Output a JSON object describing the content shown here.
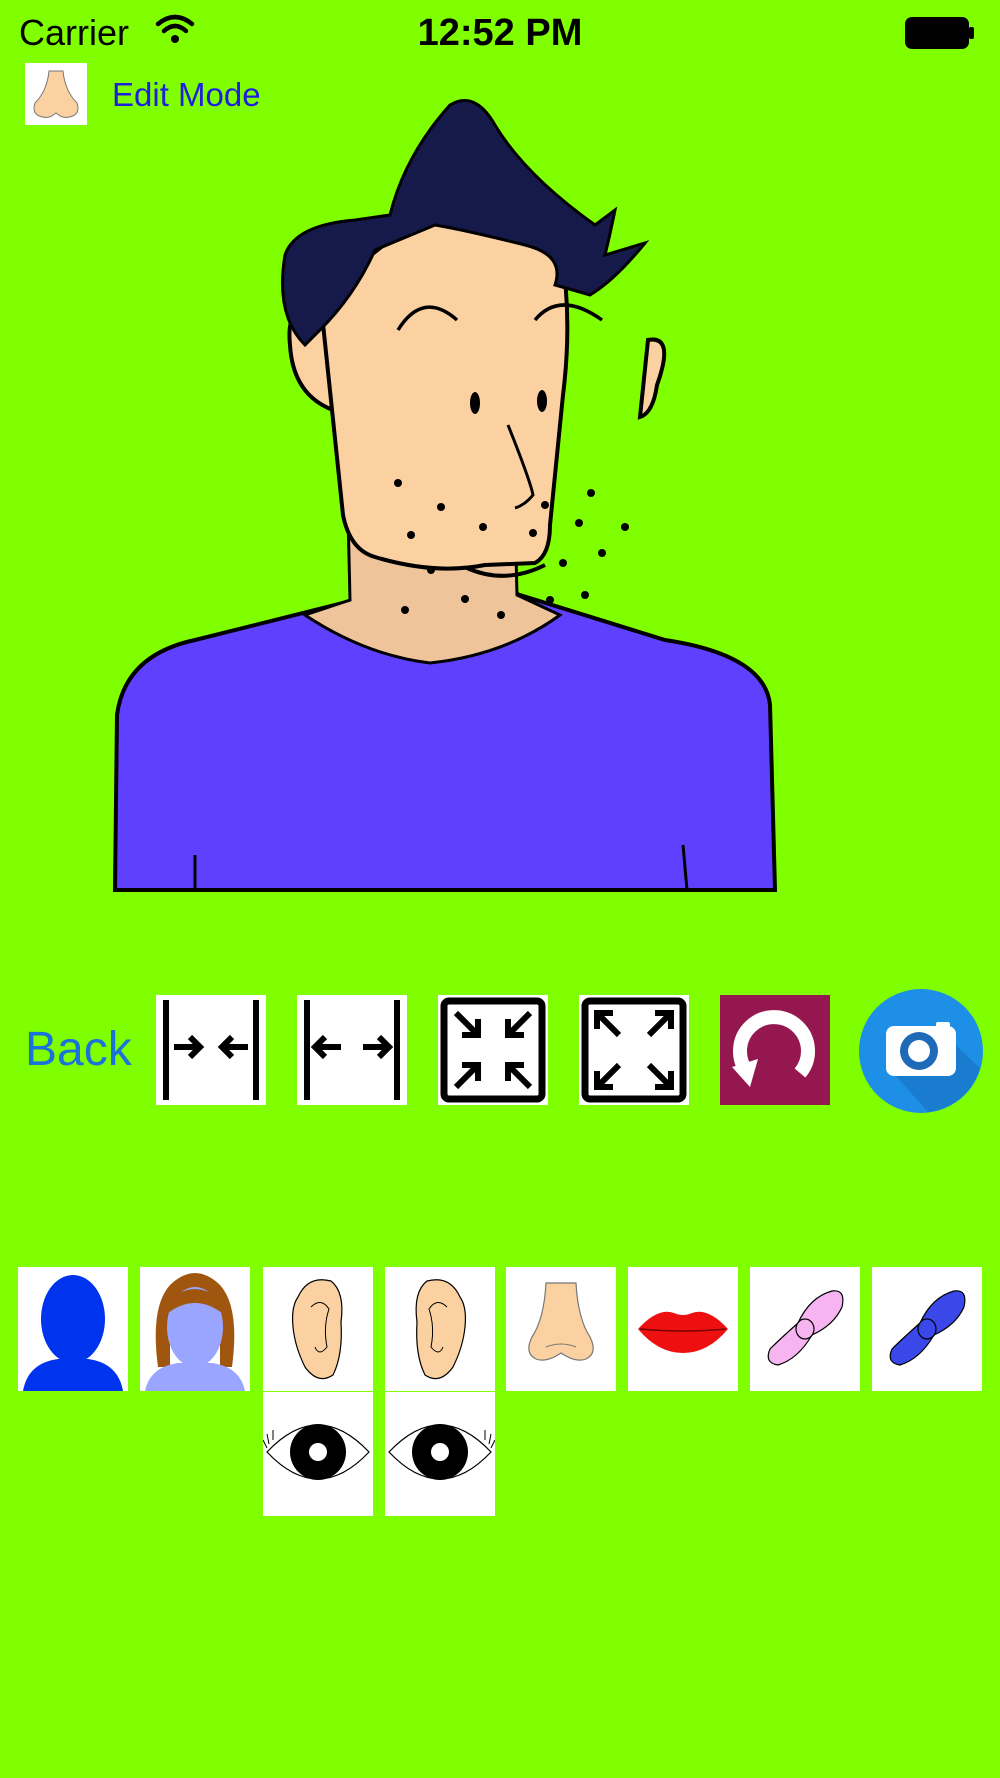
{
  "status_bar": {
    "carrier": "Carrier",
    "time": "12:52 PM"
  },
  "header": {
    "mode_label": "Edit Mode",
    "thumbnail_icon": "nose-icon"
  },
  "canvas": {
    "background": "#80ff00",
    "skin": "#fbd1a2",
    "hair": "#151a4a",
    "shirt": "#6040ff"
  },
  "toolbar": {
    "back_label": "Back",
    "tools": [
      "narrow-icon",
      "widen-icon",
      "shrink-icon",
      "enlarge-icon",
      "rotate-icon",
      "camera-icon"
    ]
  },
  "parts_palette": {
    "items": [
      "male-head-icon",
      "female-head-icon",
      "left-ear-icon",
      "right-ear-icon",
      "nose-icon",
      "lips-icon",
      "pink-bow-tie-icon",
      "blue-bow-tie-icon",
      "left-eye-icon",
      "right-eye-icon"
    ]
  }
}
